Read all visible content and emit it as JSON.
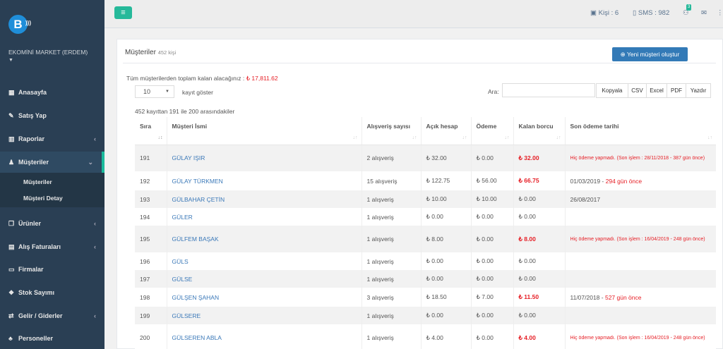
{
  "sidebar": {
    "logo_letter": "B",
    "shop_name": "EKOMİNİ MARKET (ERDEM)",
    "items": [
      {
        "label": "Anasayfa",
        "icon": "dashboard-icon"
      },
      {
        "label": "Satış Yap",
        "icon": "edit-icon"
      },
      {
        "label": "Raporlar",
        "icon": "bar-chart-icon"
      },
      {
        "label": "Müşteriler",
        "icon": "person-icon"
      },
      {
        "label": "Ürünler",
        "icon": "copy-icon"
      },
      {
        "label": "Alış Faturaları",
        "icon": "file-icon"
      },
      {
        "label": "Firmalar",
        "icon": "card-icon"
      },
      {
        "label": "Stok Sayımı",
        "icon": "cubes-icon"
      },
      {
        "label": "Gelir / Giderler",
        "icon": "exchange-icon"
      },
      {
        "label": "Personeller",
        "icon": "users-icon"
      }
    ],
    "sub_items": [
      "Müşteriler",
      "Müşteri Detay"
    ]
  },
  "topbar": {
    "kisi": "Kişi : 6",
    "sms": "SMS : 982",
    "badge": "3"
  },
  "panel": {
    "title": "Müşteriler",
    "count": "452 kişi",
    "new_button": "Yeni müşteri oluştur",
    "total_label": "Tüm müşterilerden toplam kalan alacağınız :",
    "total_value": "₺ 17,811.62",
    "page_size": "10",
    "show_label": "kayıt göster",
    "search_label": "Ara:",
    "export_buttons": [
      "Kopyala",
      "CSV",
      "Excel",
      "PDF",
      "Yazdır"
    ],
    "info": "452 kayıttan 191 ile 200 arasındakiler"
  },
  "table": {
    "headers": [
      "Sıra",
      "Müşteri İsmi",
      "Alışveriş sayısı",
      "Açık hesap",
      "Ödeme",
      "Kalan borcu",
      "Son ödeme tarihi"
    ],
    "rows": [
      {
        "no": "191",
        "name": "GÜLAY IŞIR",
        "count": "2 alışveriş",
        "open": "₺ 32.00",
        "paid": "₺ 0.00",
        "left": "₺ 32.00",
        "left_red": true,
        "last": "Hiç ödeme yapmadı. (Son işlem : 28/11/2018 - 387 gün önce)",
        "last_type": "warn"
      },
      {
        "no": "192",
        "name": "GÜLAY TÜRKMEN",
        "count": "15 alışveriş",
        "open": "₺ 122.75",
        "paid": "₺ 56.00",
        "left": "₺ 66.75",
        "left_red": true,
        "last": "01/03/2019 - ",
        "last_ago": "294 gün önce",
        "last_type": "date"
      },
      {
        "no": "193",
        "name": "GÜLBAHAR ÇETİN",
        "count": "1 alışveriş",
        "open": "₺ 10.00",
        "paid": "₺ 10.00",
        "left": "₺ 0.00",
        "left_red": false,
        "last": "26/08/2017",
        "last_type": "plain"
      },
      {
        "no": "194",
        "name": "GÜLER",
        "count": "1 alışveriş",
        "open": "₺ 0.00",
        "paid": "₺ 0.00",
        "left": "₺ 0.00",
        "left_red": false,
        "last": "",
        "last_type": "plain"
      },
      {
        "no": "195",
        "name": "GÜLFEM BAŞAK",
        "count": "1 alışveriş",
        "open": "₺ 8.00",
        "paid": "₺ 0.00",
        "left": "₺ 8.00",
        "left_red": true,
        "last": "Hiç ödeme yapmadı. (Son işlem : 16/04/2019 - 248 gün önce)",
        "last_type": "warn"
      },
      {
        "no": "196",
        "name": "GÜLS",
        "count": "1 alışveriş",
        "open": "₺ 0.00",
        "paid": "₺ 0.00",
        "left": "₺ 0.00",
        "left_red": false,
        "last": "",
        "last_type": "plain"
      },
      {
        "no": "197",
        "name": "GÜLSE",
        "count": "1 alışveriş",
        "open": "₺ 0.00",
        "paid": "₺ 0.00",
        "left": "₺ 0.00",
        "left_red": false,
        "last": "",
        "last_type": "plain"
      },
      {
        "no": "198",
        "name": "GÜLŞEN ŞAHAN",
        "count": "3 alışveriş",
        "open": "₺ 18.50",
        "paid": "₺ 7.00",
        "left": "₺ 11.50",
        "left_red": true,
        "last": "11/07/2018 - ",
        "last_ago": "527 gün önce",
        "last_type": "date"
      },
      {
        "no": "199",
        "name": "GÜLSERE",
        "count": "1 alışveriş",
        "open": "₺ 0.00",
        "paid": "₺ 0.00",
        "left": "₺ 0.00",
        "left_red": false,
        "last": "",
        "last_type": "plain"
      },
      {
        "no": "200",
        "name": "GÜLSEREN ABLA",
        "count": "1 alışveriş",
        "open": "₺ 4.00",
        "paid": "₺ 0.00",
        "left": "₺ 4.00",
        "left_red": true,
        "last": "Hiç ödeme yapmadı. (Son işlem : 16/04/2019 - 248 gün önce)",
        "last_type": "warn"
      }
    ]
  }
}
